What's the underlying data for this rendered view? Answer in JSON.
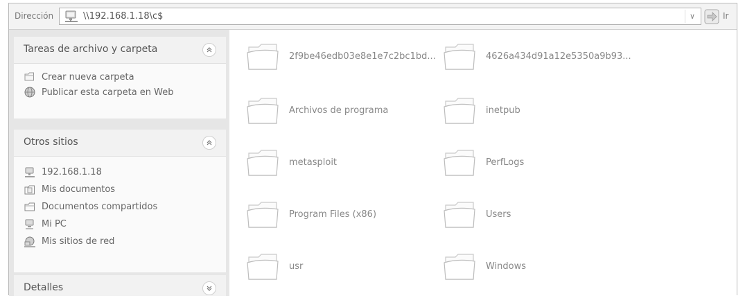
{
  "address_bar": {
    "label": "Dirección",
    "value": "\\\\192.168.1.18\\c$",
    "go_label": "Ir"
  },
  "left_pane": {
    "tasks_panel": {
      "title": "Tareas de archivo y carpeta",
      "items": [
        {
          "label": "Crear nueva carpeta",
          "icon": "new-folder-icon"
        },
        {
          "label": "Publicar esta carpeta en Web",
          "icon": "globe-icon"
        }
      ]
    },
    "sites_panel": {
      "title": "Otros sitios",
      "items": [
        {
          "label": "192.168.1.18",
          "icon": "network-computer-icon"
        },
        {
          "label": "Mis documentos",
          "icon": "documents-folder-icon"
        },
        {
          "label": "Documentos compartidos",
          "icon": "shared-folder-icon"
        },
        {
          "label": "Mi PC",
          "icon": "computer-icon"
        },
        {
          "label": "Mis sitios de red",
          "icon": "network-places-icon"
        }
      ]
    },
    "details_panel": {
      "title": "Detalles"
    }
  },
  "folders": [
    {
      "name": "2f9be46edb03e8e1e7c2bc1bd..."
    },
    {
      "name": "4626a434d91a12e5350a9b93..."
    },
    {
      "name": "Archivos de programa"
    },
    {
      "name": "inetpub"
    },
    {
      "name": "metasploit"
    },
    {
      "name": "PerfLogs"
    },
    {
      "name": "Program Files (x86)"
    },
    {
      "name": "Users"
    },
    {
      "name": "usr"
    },
    {
      "name": "Windows"
    }
  ]
}
